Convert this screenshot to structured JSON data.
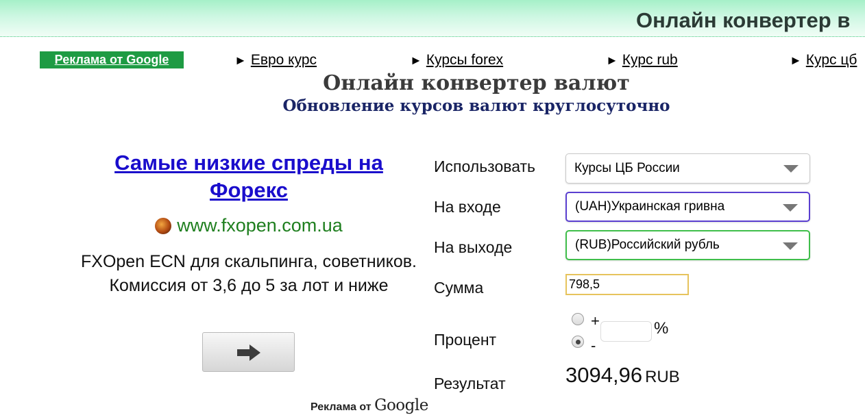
{
  "header": {
    "title": "Онлайн конвертер в"
  },
  "nav": {
    "ads_badge": "Реклама от Google",
    "links": [
      {
        "label": "Евро курс"
      },
      {
        "label": "Курсы forex"
      },
      {
        "label": "Курс rub"
      },
      {
        "label": "Курс цб"
      }
    ],
    "arrow_glyph": "►"
  },
  "page": {
    "title": "Онлайн конвертер валют",
    "subtitle": "Обновление курсов валют круглосуточно"
  },
  "ad": {
    "headline": "Самые низкие спреды на Форекс",
    "site": "www.fxopen.com.ua",
    "description": "FXOpen ECN для скальпинга, советников. Комиссия от 3,6 до 5 за лот и ниже",
    "button_icon": "arrow-right-icon"
  },
  "form": {
    "use_label": "Использовать",
    "use_value": "Курсы ЦБ России",
    "input_label": "На входе",
    "input_value": "(UAH)Украинская гривна",
    "output_label": "На выходе",
    "output_value": "(RUB)Российский рубль",
    "amount_label": "Сумма",
    "amount_value": "798,5",
    "percent_label": "Процент",
    "percent_plus": "+",
    "percent_minus": "-",
    "percent_selected": "-",
    "percent_value": "",
    "percent_sign": "%",
    "result_label": "Результат",
    "result_value": "3094,96",
    "result_unit": "RUB"
  },
  "footer_ads": {
    "prefix": "Реклама от",
    "brand": "Google"
  },
  "colors": {
    "ads_badge_bg": "#1e9b43",
    "headline_link": "#1a0dcc",
    "site_green": "#1f7f1f",
    "input_select_border": "#5a3fd0",
    "output_select_border": "#3fbe4a",
    "amount_border": "#e6c35c"
  }
}
